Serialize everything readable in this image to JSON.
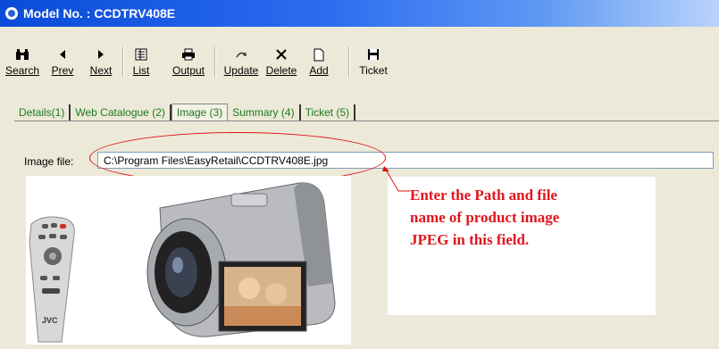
{
  "window": {
    "title": "Model No. : CCDTRV408E"
  },
  "toolbar": {
    "search": "Search",
    "prev": "Prev",
    "next": "Next",
    "list": "List",
    "output": "Output",
    "update": "Update",
    "delete": "Delete",
    "add": "Add",
    "ticket": "Ticket"
  },
  "tabs": [
    "Details(1)",
    "Web Catalogue (2)",
    "Image (3)",
    "Summary (4)",
    "Ticket (5)"
  ],
  "image_tab": {
    "label": "Image file:",
    "path": "C:\\Program Files\\EasyRetail\\CCDTRV408E.jpg"
  },
  "annotation": {
    "line1": "Enter the Path and file",
    "line2": "name of product image",
    "line3": "JPEG in this field."
  },
  "colors": {
    "annotation": "#e0151c",
    "tab_text": "#1c7a1c",
    "title_bar": "#0a4bd8"
  }
}
